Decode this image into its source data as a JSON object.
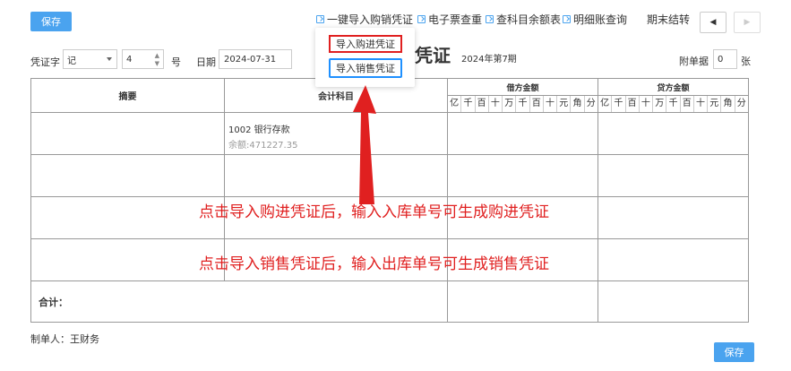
{
  "toolbar": {
    "save_label": "保存",
    "links": [
      {
        "label": "一键导入购销凭证"
      },
      {
        "label": "电子票查重"
      },
      {
        "label": "查科目余额表"
      },
      {
        "label": "明细账查询"
      }
    ],
    "period_close_label": "期末结转",
    "prev_label": "◀",
    "next_label": "▶"
  },
  "dropdown": {
    "import_purchase_label": "导入购进凭证",
    "import_sales_label": "导入销售凭证"
  },
  "header": {
    "voucher_type_label": "凭证字",
    "voucher_type_value": "记",
    "voucher_number_value": "4",
    "number_suffix": "号",
    "date_label": "日期",
    "date_value": "2024-07-31",
    "title": "凭证",
    "period": "2024年第7期",
    "attachments_label": "附单据",
    "attachments_value": "0",
    "attachments_unit": "张"
  },
  "table": {
    "summary_header": "摘要",
    "account_header": "会计科目",
    "debit_header": "借方金额",
    "credit_header": "贷方金额",
    "units": [
      "亿",
      "千",
      "百",
      "十",
      "万",
      "千",
      "百",
      "十",
      "元",
      "角",
      "分"
    ],
    "rows": [
      {
        "account": "1002 银行存款",
        "balance": "余额:471227.35"
      },
      {
        "account": "",
        "balance": ""
      },
      {
        "account": "",
        "balance": ""
      },
      {
        "account": "",
        "balance": ""
      }
    ],
    "total_label": "合计："
  },
  "annotations": {
    "hint_purchase": "点击导入购进凭证后，输入入库单号可生成购进凭证",
    "hint_sales": "点击导入销售凭证后，输入出库单号可生成销售凭证",
    "accent_red": "#e02020",
    "accent_blue": "#1e90ff"
  },
  "footer": {
    "maker": "制单人：王财务",
    "save_label": "保存"
  }
}
